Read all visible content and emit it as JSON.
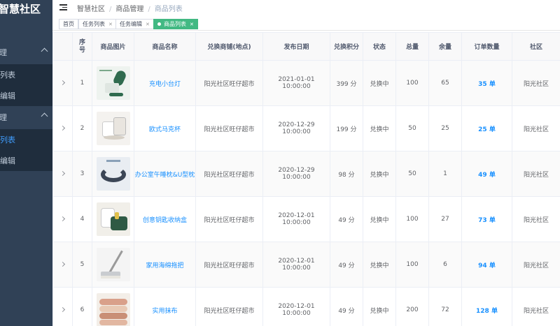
{
  "app": {
    "logo": "智慧社区"
  },
  "sidebar": {
    "groups": [
      {
        "label": "管理",
        "items": [
          {
            "label": "务列表"
          },
          {
            "label": "务编辑"
          }
        ]
      },
      {
        "label": "管理",
        "items": [
          {
            "label": "品列表"
          },
          {
            "label": "品编辑"
          }
        ]
      }
    ]
  },
  "header": {
    "breadcrumb": [
      "智慧社区",
      "商品管理",
      "商品列表"
    ]
  },
  "tags": [
    {
      "label": "首页"
    },
    {
      "label": "任务列表"
    },
    {
      "label": "任务编辑"
    },
    {
      "label": "商品列表"
    }
  ],
  "table": {
    "columns": [
      "",
      "序号",
      "商品图片",
      "商品名称",
      "兑换商铺(地点)",
      "发布日期",
      "兑换积分",
      "状态",
      "总量",
      "余量",
      "订单数量",
      "社区"
    ],
    "rows": [
      {
        "index": "1",
        "image": "desk-lamp",
        "name": "充电小台灯",
        "shop": "阳光社区旺仔超市",
        "date": "2021-01-01 10:00:00",
        "points": "399 分",
        "status": "兑换中",
        "total": "100",
        "remain": "65",
        "orders": "35 单",
        "community": "阳光社区"
      },
      {
        "index": "2",
        "image": "mug",
        "name": "欧式马克杯",
        "shop": "阳光社区旺仔超市",
        "date": "2020-12-29 10:00:00",
        "points": "199 分",
        "status": "兑换中",
        "total": "50",
        "remain": "25",
        "orders": "25 单",
        "community": "阳光社区"
      },
      {
        "index": "3",
        "image": "u-pillow",
        "name": "办公室午睡枕&U型枕",
        "shop": "阳光社区旺仔超市",
        "date": "2020-12-29 10:00:00",
        "points": "98 分",
        "status": "兑换中",
        "total": "50",
        "remain": "1",
        "orders": "49 单",
        "community": "阳光社区"
      },
      {
        "index": "4",
        "image": "storage-box",
        "name": "创意钥匙收纳盒",
        "shop": "阳光社区旺仔超市",
        "date": "2020-12-01 10:00:00",
        "points": "49 分",
        "status": "兑换中",
        "total": "100",
        "remain": "27",
        "orders": "73 单",
        "community": "阳光社区"
      },
      {
        "index": "5",
        "image": "sponge-mop",
        "name": "家用海绵拖把",
        "shop": "阳光社区旺仔超市",
        "date": "2020-12-01 10:00:00",
        "points": "49 分",
        "status": "兑换中",
        "total": "100",
        "remain": "6",
        "orders": "94 单",
        "community": "阳光社区"
      },
      {
        "index": "6",
        "image": "rags",
        "name": "实用抹布",
        "shop": "阳光社区旺仔超市",
        "date": "2020-12-01 10:00:00",
        "points": "49 分",
        "status": "兑换中",
        "total": "200",
        "remain": "72",
        "orders": "128 单",
        "community": "阳光社区"
      }
    ]
  }
}
